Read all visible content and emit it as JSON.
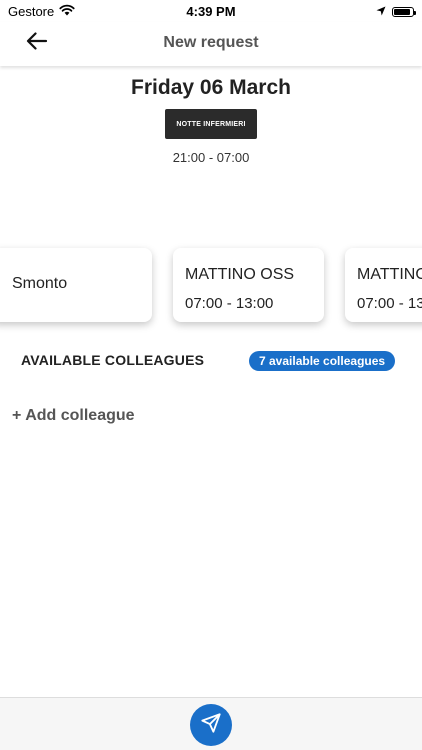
{
  "status_bar": {
    "carrier": "Gestore",
    "time": "4:39 PM",
    "battery_level": 0.9,
    "icons": [
      "wifi-icon",
      "location-arrow-icon",
      "battery-icon"
    ]
  },
  "nav": {
    "title": "New request",
    "back_icon": "arrow-left-icon"
  },
  "day": {
    "title": "Friday 06 March",
    "shift_tag": "NOTTE INFERMIERI",
    "shift_time": "21:00 - 07:00"
  },
  "shifts": [
    {
      "name": "Smonto",
      "time": ""
    },
    {
      "name": "MATTINO OSS",
      "time": "07:00 - 13:00"
    },
    {
      "name": "MATTINO",
      "time": "07:00 - 13:00"
    }
  ],
  "colleagues": {
    "heading": "AVAILABLE COLLEAGUES",
    "badge": "7 available colleagues",
    "add_label": "+ Add colleague"
  },
  "bottom_bar": {
    "send_icon": "send-icon"
  },
  "colors": {
    "accent": "#1a6fc9",
    "tag_background": "#2b2b2b"
  }
}
